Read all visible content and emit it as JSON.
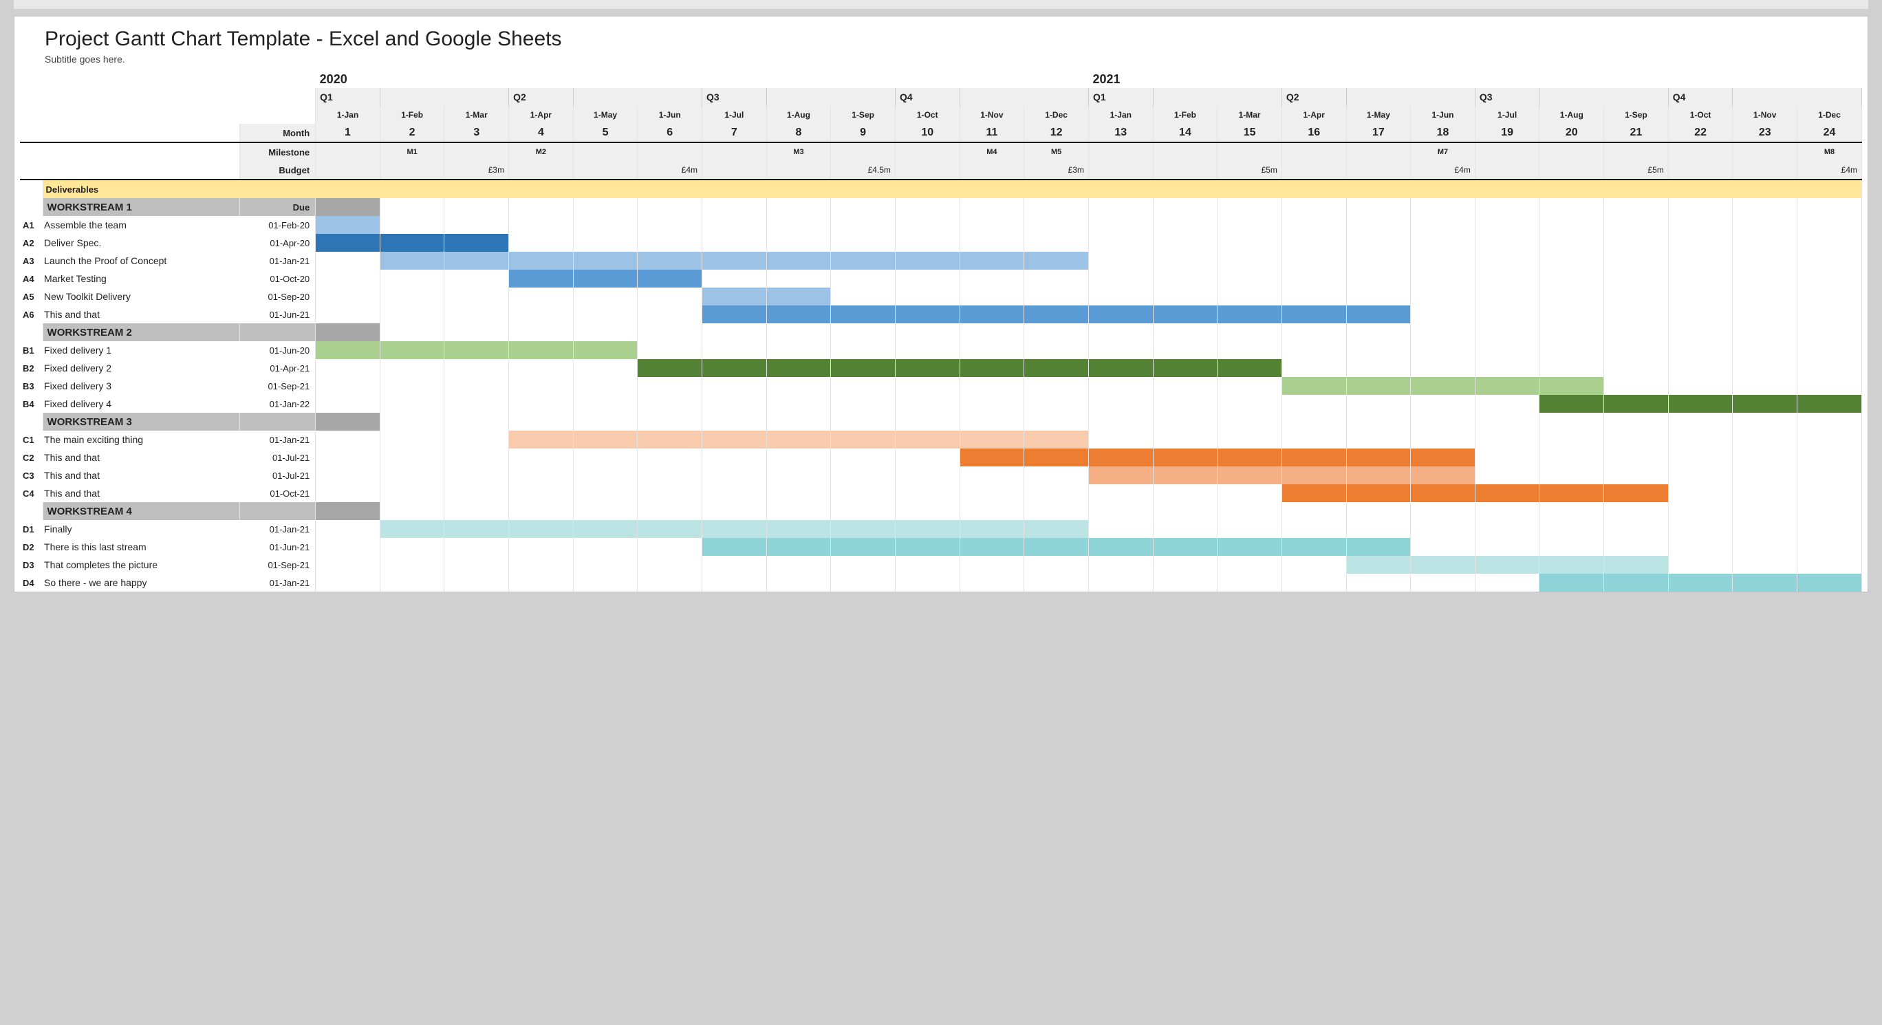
{
  "title": "Project Gantt Chart Template - Excel and Google Sheets",
  "subtitle": "Subtitle goes here.",
  "header": {
    "month_label": "Month",
    "milestone_label": "Milestone",
    "budget_label": "Budget",
    "deliverables_label": "Deliverables",
    "due_label": "Due",
    "years": [
      "2020",
      "2021"
    ],
    "quarters": [
      "Q1",
      "Q2",
      "Q3",
      "Q4",
      "Q1",
      "Q2",
      "Q3",
      "Q4"
    ],
    "dates": [
      "1-Jan",
      "1-Feb",
      "1-Mar",
      "1-Apr",
      "1-May",
      "1-Jun",
      "1-Jul",
      "1-Aug",
      "1-Sep",
      "1-Oct",
      "1-Nov",
      "1-Dec",
      "1-Jan",
      "1-Feb",
      "1-Mar",
      "1-Apr",
      "1-May",
      "1-Jun",
      "1-Jul",
      "1-Aug",
      "1-Sep",
      "1-Oct",
      "1-Nov",
      "1-Dec"
    ],
    "nums": [
      "1",
      "2",
      "3",
      "4",
      "5",
      "6",
      "7",
      "8",
      "9",
      "10",
      "11",
      "12",
      "13",
      "14",
      "15",
      "16",
      "17",
      "18",
      "19",
      "20",
      "21",
      "22",
      "23",
      "24"
    ],
    "milestones": [
      "",
      "M1",
      "",
      "M2",
      "",
      "",
      "",
      "M3",
      "",
      "",
      "M4",
      "M5",
      "",
      "",
      "",
      "",
      "",
      "M7",
      "",
      "",
      "",
      "",
      "",
      "M8"
    ],
    "budgets": [
      "",
      "",
      "£3m",
      "",
      "",
      "£4m",
      "",
      "",
      "£4.5m",
      "",
      "",
      "£3m",
      "",
      "",
      "£5m",
      "",
      "",
      "£4m",
      "",
      "",
      "£5m",
      "",
      "",
      "£4m"
    ]
  },
  "workstreams": [
    {
      "name": "WORKSTREAM 1",
      "tasks": [
        {
          "code": "A1",
          "name": "Assemble the team",
          "due": "01-Feb-20"
        },
        {
          "code": "A2",
          "name": "Deliver Spec.",
          "due": "01-Apr-20"
        },
        {
          "code": "A3",
          "name": "Launch the Proof of Concept",
          "due": "01-Jan-21"
        },
        {
          "code": "A4",
          "name": "Market Testing",
          "due": "01-Oct-20"
        },
        {
          "code": "A5",
          "name": "New Toolkit Delivery",
          "due": "01-Sep-20"
        },
        {
          "code": "A6",
          "name": "This and that",
          "due": "01-Jun-21"
        }
      ]
    },
    {
      "name": "WORKSTREAM 2",
      "tasks": [
        {
          "code": "B1",
          "name": "Fixed delivery 1",
          "due": "01-Jun-20"
        },
        {
          "code": "B2",
          "name": "Fixed delivery 2",
          "due": "01-Apr-21"
        },
        {
          "code": "B3",
          "name": "Fixed delivery 3",
          "due": "01-Sep-21"
        },
        {
          "code": "B4",
          "name": "Fixed delivery 4",
          "due": "01-Jan-22"
        }
      ]
    },
    {
      "name": "WORKSTREAM 3",
      "tasks": [
        {
          "code": "C1",
          "name": "The main exciting thing",
          "due": "01-Jan-21"
        },
        {
          "code": "C2",
          "name": "This and that",
          "due": "01-Jul-21"
        },
        {
          "code": "C3",
          "name": "This and that",
          "due": "01-Jul-21"
        },
        {
          "code": "C4",
          "name": "This and that",
          "due": "01-Oct-21"
        }
      ]
    },
    {
      "name": "WORKSTREAM 4",
      "tasks": [
        {
          "code": "D1",
          "name": "Finally",
          "due": "01-Jan-21"
        },
        {
          "code": "D2",
          "name": "There is this last stream",
          "due": "01-Jun-21"
        },
        {
          "code": "D3",
          "name": "That completes the picture",
          "due": "01-Sep-21"
        },
        {
          "code": "D4",
          "name": "So there - we are happy",
          "due": "01-Jan-21"
        }
      ]
    }
  ],
  "chart_data": {
    "type": "bar",
    "title": "Project Gantt Chart Template - Excel and Google Sheets",
    "xlabel": "Month",
    "ylabel": "",
    "categories": [
      "2020-01",
      "2020-02",
      "2020-03",
      "2020-04",
      "2020-05",
      "2020-06",
      "2020-07",
      "2020-08",
      "2020-09",
      "2020-10",
      "2020-11",
      "2020-12",
      "2021-01",
      "2021-02",
      "2021-03",
      "2021-04",
      "2021-05",
      "2021-06",
      "2021-07",
      "2021-08",
      "2021-09",
      "2021-10",
      "2021-11",
      "2021-12"
    ],
    "milestones": {
      "M1": 2,
      "M2": 4,
      "M3": 8,
      "M4": 11,
      "M5": 12,
      "M7": 18,
      "M8": 24
    },
    "budgets_by_quarter": {
      "2020-Q1": "£3m",
      "2020-Q2": "£4m",
      "2020-Q3": "£4.5m",
      "2020-Q4": "£3m",
      "2021-Q1": "£5m",
      "2021-Q2": "£4m",
      "2021-Q3": "£5m",
      "2021-Q4": "£4m"
    },
    "series": [
      {
        "group": "WORKSTREAM 1",
        "code": "A1",
        "name": "Assemble the team",
        "start": 1,
        "end": 1,
        "shade": "light"
      },
      {
        "group": "WORKSTREAM 1",
        "code": "A2",
        "name": "Deliver Spec.",
        "start": 1,
        "end": 3,
        "shade": "dark"
      },
      {
        "group": "WORKSTREAM 1",
        "code": "A3",
        "name": "Launch the Proof of Concept",
        "start": 2,
        "end": 12,
        "shade": "light"
      },
      {
        "group": "WORKSTREAM 1",
        "code": "A4",
        "name": "Market Testing",
        "start": 4,
        "end": 6,
        "shade": "mid"
      },
      {
        "group": "WORKSTREAM 1",
        "code": "A5",
        "name": "New Toolkit Delivery",
        "start": 7,
        "end": 8,
        "shade": "light"
      },
      {
        "group": "WORKSTREAM 1",
        "code": "A6",
        "name": "This and that",
        "start": 7,
        "end": 17,
        "shade": "mid"
      },
      {
        "group": "WORKSTREAM 2",
        "code": "B1",
        "name": "Fixed delivery 1",
        "start": 1,
        "end": 5,
        "shade": "light"
      },
      {
        "group": "WORKSTREAM 2",
        "code": "B2",
        "name": "Fixed delivery 2",
        "start": 6,
        "end": 15,
        "shade": "dark"
      },
      {
        "group": "WORKSTREAM 2",
        "code": "B3",
        "name": "Fixed delivery 3",
        "start": 16,
        "end": 20,
        "shade": "light"
      },
      {
        "group": "WORKSTREAM 2",
        "code": "B4",
        "name": "Fixed delivery 4",
        "start": 20,
        "end": 24,
        "shade": "dark"
      },
      {
        "group": "WORKSTREAM 3",
        "code": "C1",
        "name": "The main exciting thing",
        "start": 4,
        "end": 12,
        "shade": "light"
      },
      {
        "group": "WORKSTREAM 3",
        "code": "C2",
        "name": "This and that",
        "start": 11,
        "end": 18,
        "shade": "dark"
      },
      {
        "group": "WORKSTREAM 3",
        "code": "C3",
        "name": "This and that",
        "start": 13,
        "end": 18,
        "shade": "mid"
      },
      {
        "group": "WORKSTREAM 3",
        "code": "C4",
        "name": "This and that",
        "start": 16,
        "end": 21,
        "shade": "dark"
      },
      {
        "group": "WORKSTREAM 4",
        "code": "D1",
        "name": "Finally",
        "start": 2,
        "end": 12,
        "shade": "light"
      },
      {
        "group": "WORKSTREAM 4",
        "code": "D2",
        "name": "There is this last stream",
        "start": 7,
        "end": 17,
        "shade": "mid"
      },
      {
        "group": "WORKSTREAM 4",
        "code": "D3",
        "name": "That completes the picture",
        "start": 17,
        "end": 21,
        "shade": "light"
      },
      {
        "group": "WORKSTREAM 4",
        "code": "D4",
        "name": "So there - we are happy",
        "start": 20,
        "end": 24,
        "shade": "mid"
      }
    ]
  }
}
